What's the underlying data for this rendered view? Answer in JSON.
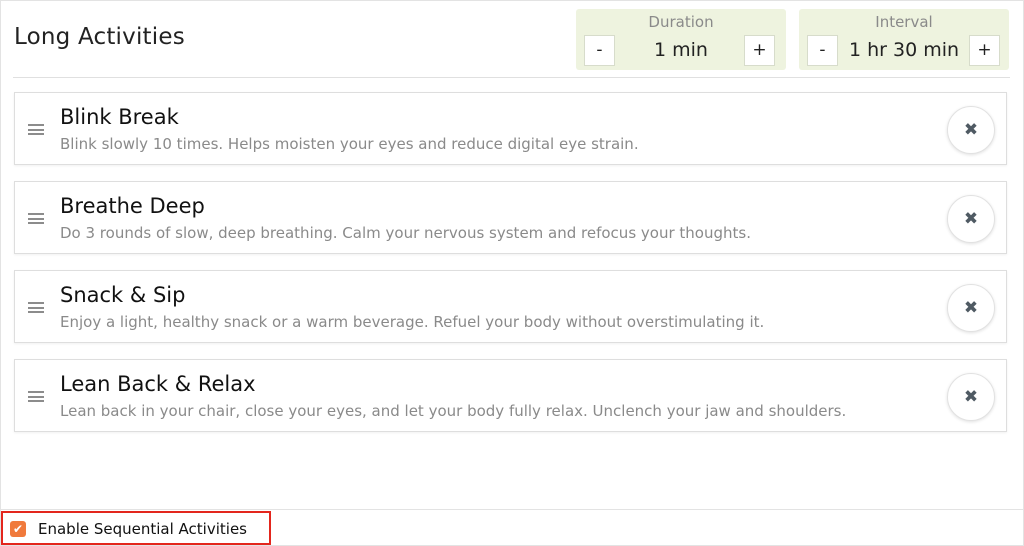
{
  "header": {
    "title": "Long Activities",
    "duration": {
      "label": "Duration",
      "value": "1 min",
      "minus": "-",
      "plus": "+"
    },
    "interval": {
      "label": "Interval",
      "value": "1 hr 30 min",
      "minus": "-",
      "plus": "+"
    }
  },
  "activities": [
    {
      "name": "Blink Break",
      "description": "Blink slowly 10 times. Helps moisten your eyes and reduce digital eye strain."
    },
    {
      "name": "Breathe Deep",
      "description": "Do 3 rounds of slow, deep breathing. Calm your nervous system and refocus your thoughts."
    },
    {
      "name": "Snack & Sip",
      "description": "Enjoy a light, healthy snack or a warm beverage. Refuel your body without overstimulating it."
    },
    {
      "name": "Lean Back & Relax",
      "description": "Lean back in your chair, close your eyes, and let your body fully relax. Unclench your jaw and shoulders."
    }
  ],
  "icons": {
    "remove": "✖",
    "drag": "drag-handle-icon",
    "check": "✔"
  },
  "footer": {
    "sequential_label": "Enable Sequential Activities",
    "sequential_checked": true
  },
  "colors": {
    "accent": "#f07a3c",
    "control_bg": "#eef3df",
    "highlight_border": "#e3261d"
  }
}
